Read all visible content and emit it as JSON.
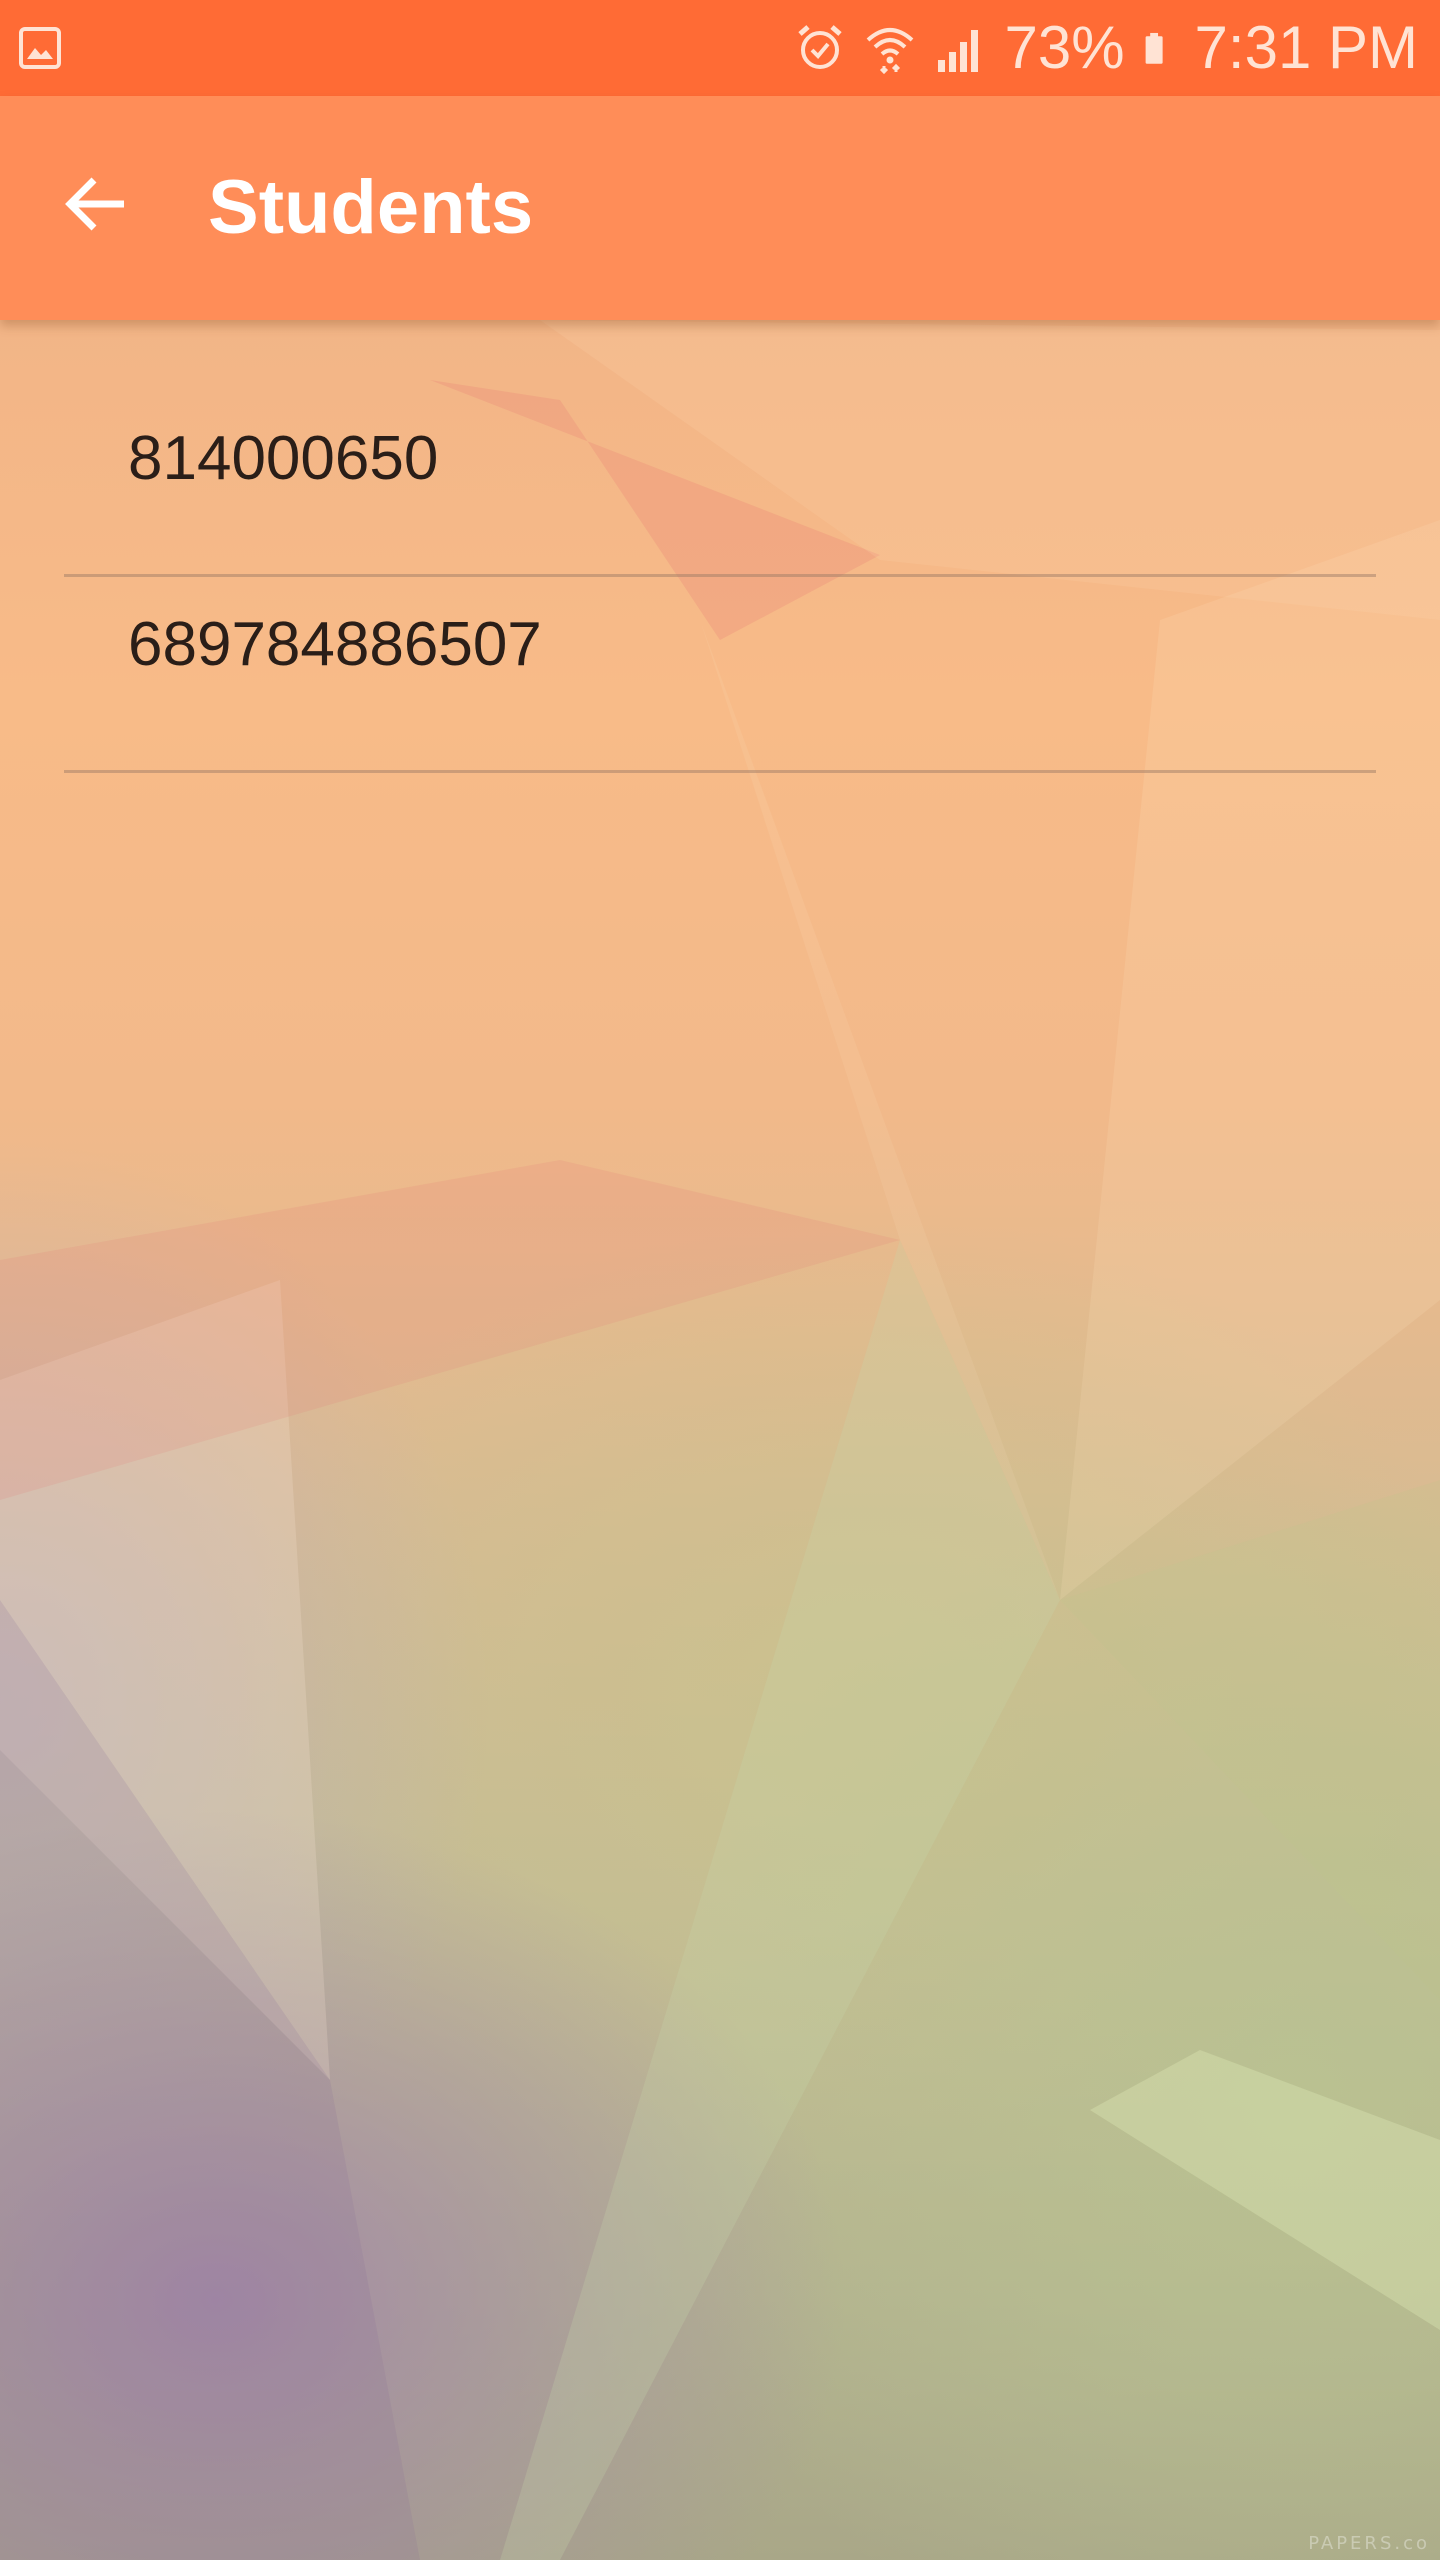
{
  "status_bar": {
    "battery_percent": "73%",
    "time": "7:31 PM",
    "icons": [
      "gallery-icon",
      "alarm-icon",
      "wifi-icon",
      "signal-icon",
      "battery-icon"
    ]
  },
  "app_bar": {
    "title": "Students",
    "back_icon": "arrow-left-icon"
  },
  "students": [
    {
      "id": "814000650"
    },
    {
      "id": "689784886507"
    }
  ],
  "watermark": "PAPERS.co",
  "colors": {
    "status_bar": "#ff6b35",
    "app_bar": "#ff8d58",
    "title_text": "#ffffff",
    "list_text": "#2a1e18"
  }
}
